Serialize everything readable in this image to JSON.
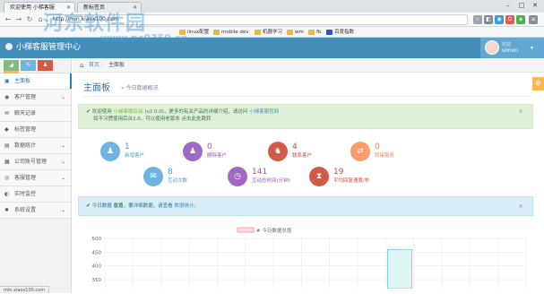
{
  "browser": {
    "tabs": [
      {
        "title": "欢迎使用 小梯客服",
        "active": true
      },
      {
        "title": "新标签页",
        "active": false
      }
    ],
    "url": "http://min.kiaox100.com",
    "bookmarks": [
      "linux配置",
      "mobile dev",
      "机器学习",
      "wm",
      "fb",
      "百度指数"
    ]
  },
  "header": {
    "brand": "小梯客服管理中心",
    "user_welcome": "欢迎",
    "user_name": "simon"
  },
  "sidebar": {
    "items": [
      {
        "label": "主面板",
        "icon": "dashboard-icon",
        "glyph": "▣",
        "active": true,
        "has_caret": false
      },
      {
        "label": "客户管理",
        "icon": "users-icon",
        "glyph": "◉",
        "active": false,
        "has_caret": true
      },
      {
        "label": "聊天记录",
        "icon": "chat-icon",
        "glyph": "✉",
        "active": false,
        "has_caret": false
      },
      {
        "label": "标签管理",
        "icon": "tag-icon",
        "glyph": "◆",
        "active": false,
        "has_caret": false
      },
      {
        "label": "数据统计",
        "icon": "bar-chart-icon",
        "glyph": "▤",
        "active": false,
        "has_caret": true
      },
      {
        "label": "公司账号管理",
        "icon": "building-icon",
        "glyph": "▦",
        "active": false,
        "has_caret": true
      },
      {
        "label": "客服管理",
        "icon": "headset-icon",
        "glyph": "◎",
        "active": false,
        "has_caret": true
      },
      {
        "label": "实时监控",
        "icon": "eye-icon",
        "glyph": "◐",
        "active": false,
        "has_caret": false
      },
      {
        "label": "系统设置",
        "icon": "cog-icon",
        "glyph": "✹",
        "active": false,
        "has_caret": true
      }
    ],
    "shortcut_colors": [
      "#87b87f",
      "#6fb3e0",
      "#d15b47",
      "#ffb752"
    ]
  },
  "breadcrumb": {
    "home": "首页",
    "current": "主面板"
  },
  "page": {
    "title": "主面板",
    "subtitle": "今日数据概况"
  },
  "alerts": {
    "welcome_line1_a": "欢迎使用",
    "welcome_line1_b": "小梯客服后台",
    "welcome_line1_c": "(v2.0.0)",
    "welcome_line1_d": "，更多的有关产品的详细介绍，请访问",
    "welcome_line1_link": "小梯客服官网",
    "welcome_line2": "如不习惯使用后台2.0，可以使用老版本 点击此处跳转",
    "today_a": "今日数据",
    "today_link1": "总览",
    "today_b": "，要详细数据，请查看",
    "today_link2": "数据统计",
    "today_c": "。"
  },
  "stats": [
    {
      "value": "1",
      "label": "新增客户",
      "color": "#6fb3e0",
      "text_color": "#4f99c6",
      "icon": "user-plus-icon",
      "glyph": "♟"
    },
    {
      "value": "0",
      "label": "删除客户",
      "color": "#a069c3",
      "text_color": "#9a59b6",
      "icon": "user-remove-icon",
      "glyph": "♟"
    },
    {
      "value": "4",
      "label": "联系客户",
      "color": "#d15b47",
      "text_color": "#c44f3c",
      "icon": "contacts-icon",
      "glyph": "♞"
    },
    {
      "value": "0",
      "label": "转接服务",
      "color": "#fc9d6b",
      "text_color": "#e8855a",
      "icon": "transfer-icon",
      "glyph": "⇄"
    },
    {
      "value": "8",
      "label": "互动次数",
      "color": "#6fb3e0",
      "text_color": "#4f99c6",
      "icon": "chat-bubble-icon",
      "glyph": "✉"
    },
    {
      "value": "141",
      "label": "互动总时间(分钟)",
      "color": "#a069c3",
      "text_color": "#9a59b6",
      "icon": "clock-icon",
      "glyph": "◷"
    },
    {
      "value": "19",
      "label": "平均回复速度/秒",
      "color": "#d15b47",
      "text_color": "#c44f3c",
      "icon": "hourglass-icon",
      "glyph": "⧗"
    }
  ],
  "chart_data": {
    "type": "bar",
    "legend": [
      "# 今日数据总揽"
    ],
    "yticks": [
      500,
      450,
      400,
      350
    ],
    "ylim": [
      300,
      500
    ],
    "bar_colors": {
      "fill": "#dff4f4",
      "stroke": "#4bc0c0",
      "legend_fill": "#fde1e4",
      "legend_stroke": "#ff6384"
    },
    "values": [
      null,
      null,
      null,
      null,
      null,
      null,
      null,
      null,
      null,
      null,
      460,
      null,
      null,
      null,
      null
    ]
  },
  "status_text": "min.xiaox100.com",
  "watermark": {
    "text": "河东软件园",
    "url": "www.pc0359.cn"
  }
}
